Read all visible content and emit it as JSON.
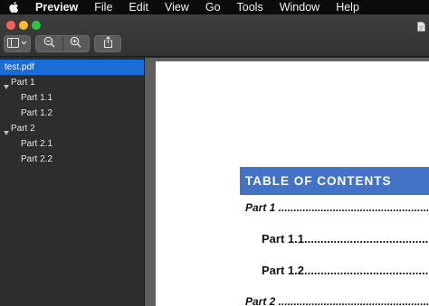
{
  "menubar": {
    "app_name": "Preview",
    "items": [
      "File",
      "Edit",
      "View",
      "Go",
      "Tools",
      "Window",
      "Help"
    ]
  },
  "toolbar": {
    "sidebar_button_icon": "sidebar-icon",
    "zoom_out_icon": "zoom-out-icon",
    "zoom_in_icon": "zoom-in-icon",
    "share_icon": "share-icon"
  },
  "sidebar": {
    "file_name": "test.pdf",
    "items": [
      {
        "label": "Part 1",
        "level": 1,
        "expanded": true
      },
      {
        "label": "Part 1.1",
        "level": 2
      },
      {
        "label": "Part 1.2",
        "level": 2
      },
      {
        "label": "Part 2",
        "level": 1,
        "expanded": true
      },
      {
        "label": "Part 2.1",
        "level": 2
      },
      {
        "label": "Part 2.2",
        "level": 2
      }
    ]
  },
  "document": {
    "toc_title": "TABLE OF CONTENTS",
    "entries": [
      "Part 1 ..........................................................",
      "Part 1.1..........................................................",
      "Part 1.2..........................................................",
      "Part 2 .........................................................."
    ]
  },
  "colors": {
    "selection": "#1c6cd6",
    "toc_header": "#4472c4",
    "close": "#fc5f57",
    "minimize": "#fdbc2e",
    "zoom": "#28c840"
  }
}
